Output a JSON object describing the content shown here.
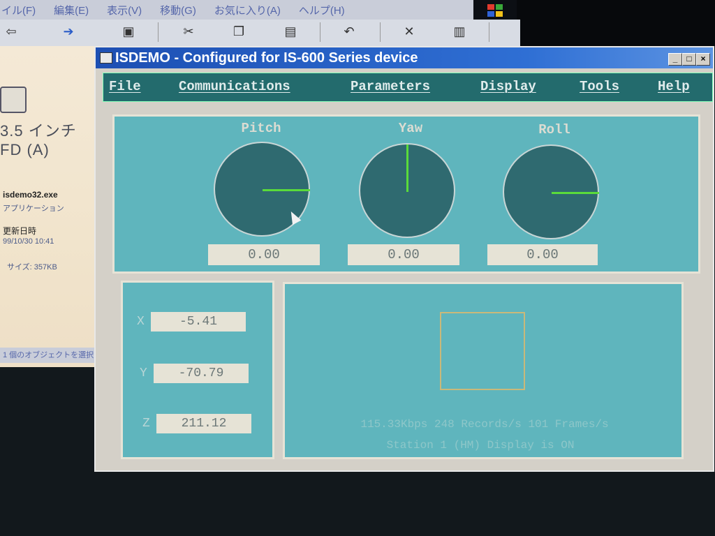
{
  "bg_window": {
    "menu": [
      "イル(F)",
      "編集(E)",
      "表示(V)",
      "移動(G)",
      "お気に入り(A)",
      "ヘルプ(H)"
    ],
    "toolbar": {
      "back_label": "戻る",
      "forward_label": "進む"
    },
    "left_pane": {
      "drive_line1": "3.5 インチ",
      "drive_line2": "FD (A)",
      "file_name": "isdemo32.exe",
      "file_type": "アプリケーション",
      "modified_label": "更新日時",
      "modified_value": "99/10/30 10:41",
      "size": "サイズ: 357KB"
    },
    "status": "1 個のオブジェクトを選択"
  },
  "app": {
    "title": "ISDEMO - Configured for IS-600 Series device",
    "menu": {
      "file": "File",
      "communications": "Communications",
      "parameters": "Parameters",
      "display": "Display",
      "tools": "Tools",
      "help": "Help"
    },
    "gauges": {
      "pitch": {
        "label": "Pitch",
        "value": "0.00"
      },
      "yaw": {
        "label": "Yaw",
        "value": "0.00"
      },
      "roll": {
        "label": "Roll",
        "value": "0.00"
      }
    },
    "coords": {
      "x": {
        "label": "X",
        "value": "-5.41"
      },
      "y": {
        "label": "Y",
        "value": "-70.79"
      },
      "z": {
        "label": "Z",
        "value": "211.12"
      }
    },
    "status_line1": "115.33Kbps  248 Records/s  101 Frames/s",
    "status_line2": "Station 1 (HM) Display is ON"
  },
  "colors": {
    "titlebar": "#1d4fb3",
    "menubar": "#236b6d",
    "panel": "#5fb5bd",
    "gauge_face": "#2f6a70",
    "needle": "#5adb3a"
  },
  "icons": [
    "windows-logo-icon",
    "back-icon",
    "forward-icon",
    "folder-icon",
    "cut-icon",
    "copy-icon",
    "paste-icon",
    "undo-icon",
    "delete-icon",
    "properties-icon",
    "floppy-drive-icon",
    "mouse-cursor-icon"
  ]
}
